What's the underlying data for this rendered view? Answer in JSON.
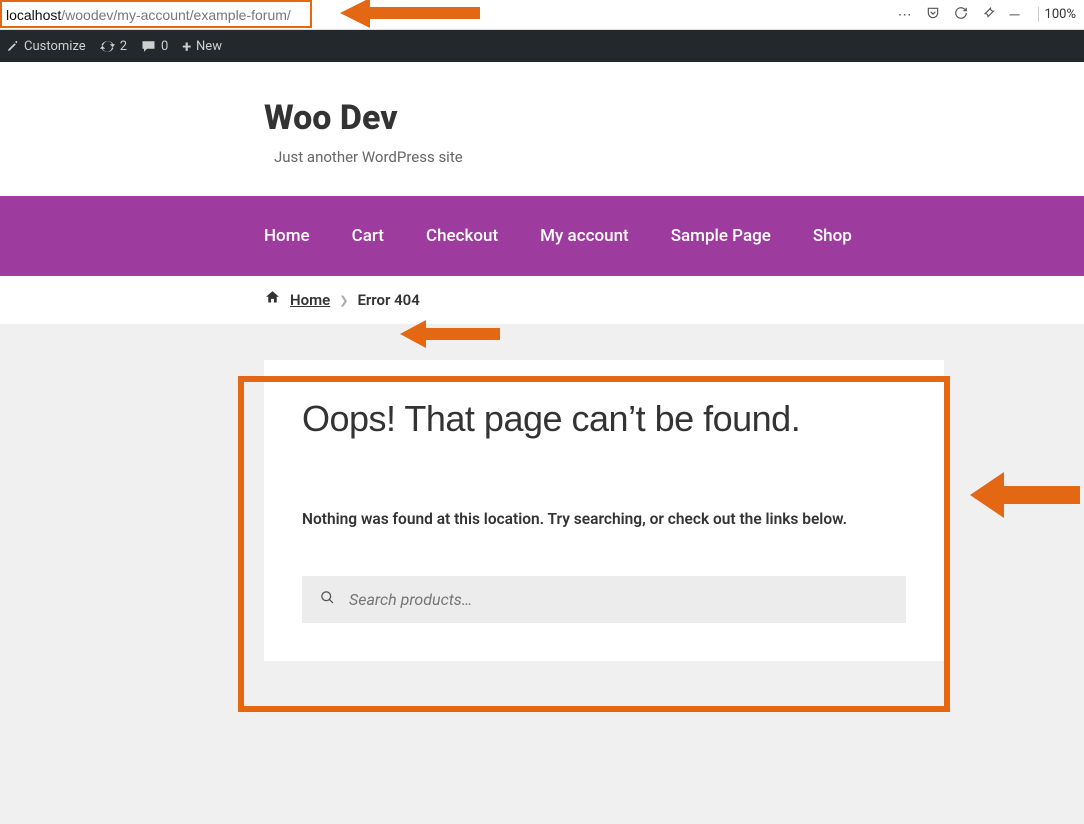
{
  "browser": {
    "url_host": "localhost",
    "url_path": "/woodev/my-account/example-forum/",
    "zoom": "100%"
  },
  "wpbar": {
    "customize": "Customize",
    "updates": "2",
    "comments": "0",
    "new": "New"
  },
  "site": {
    "title": "Woo Dev",
    "tagline": "Just another WordPress site"
  },
  "nav": {
    "items": [
      {
        "label": "Home"
      },
      {
        "label": "Cart"
      },
      {
        "label": "Checkout"
      },
      {
        "label": "My account"
      },
      {
        "label": "Sample Page"
      },
      {
        "label": "Shop"
      }
    ]
  },
  "breadcrumb": {
    "home": "Home",
    "current": "Error 404"
  },
  "page": {
    "heading": "Oops! That page can’t be found.",
    "message": "Nothing was found at this location. Try searching, or check out the links below.",
    "search_placeholder": "Search products…"
  }
}
